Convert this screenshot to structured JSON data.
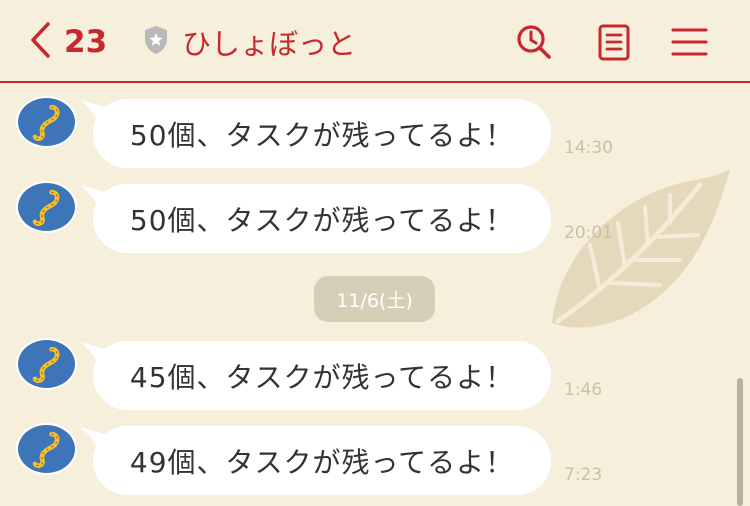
{
  "header": {
    "back_count": "23",
    "title": "ひしょぼっと",
    "accent_color": "#c8282d",
    "icons": [
      "chevron-left-icon",
      "shield-star-icon",
      "search-icon",
      "notes-icon",
      "menu-icon"
    ]
  },
  "messages": [
    {
      "text": "50個、タスクが残ってるよ！",
      "time": "14:30"
    },
    {
      "text": "50個、タスクが残ってるよ！",
      "time": "20:01"
    },
    {
      "text": "45個、タスクが残ってるよ！",
      "time": "1:46"
    },
    {
      "text": "49個、タスクが残ってるよ！",
      "time": "7:23"
    }
  ],
  "date_separator": "11/6(土)"
}
